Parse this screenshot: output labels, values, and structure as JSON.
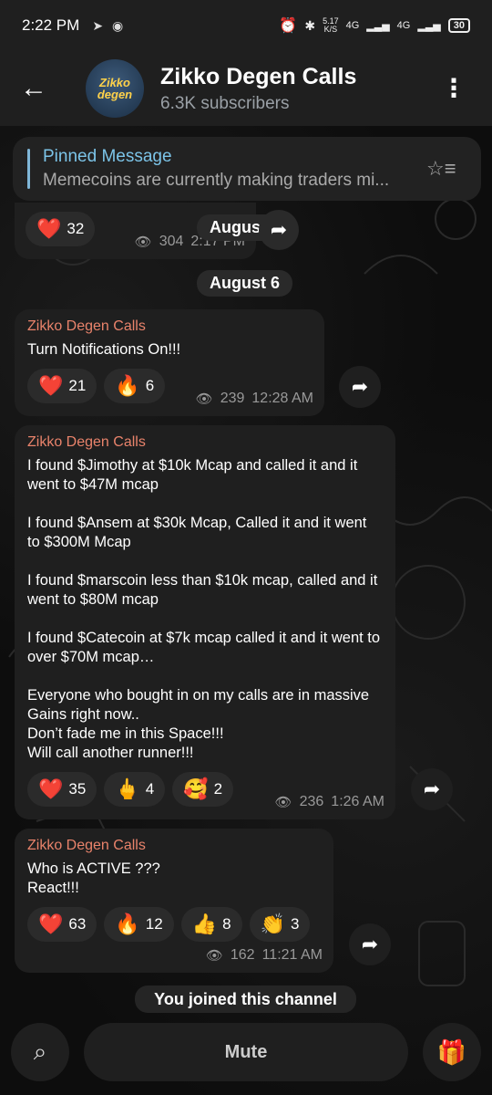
{
  "status_bar": {
    "time": "2:22 PM",
    "net_speed": "5.17\nK/S",
    "network_1": "4G",
    "network_2": "4G",
    "battery": "30"
  },
  "header": {
    "avatar_text": "Zikko degen",
    "title": "Zikko Degen Calls",
    "subscribers": "6.3K subscribers"
  },
  "pinned": {
    "title": "Pinned Message",
    "preview": "Memecoins are currently making traders mi..."
  },
  "previous_message": {
    "reaction": {
      "emoji": "❤️",
      "count": "32"
    },
    "views": "304",
    "time": "2:17 PM",
    "date_overlay": "August 5"
  },
  "date_separator": "August 6",
  "messages": [
    {
      "author": "Zikko Degen Calls",
      "text": "Turn Notifications On!!!",
      "reactions": [
        {
          "emoji": "❤️",
          "count": "21"
        },
        {
          "emoji": "🔥",
          "count": "6"
        }
      ],
      "views": "239",
      "time": "12:28 AM"
    },
    {
      "author": "Zikko Degen Calls",
      "text": "I found $Jimothy at $10k Mcap and called it and it went to $47M mcap\n\nI found  $Ansem at $30k Mcap, Called it and it went to $300M Mcap\n\nI found $marscoin less than $10k mcap, called and it went to $80M mcap\n\nI found $Catecoin at $7k mcap called it and it went to over $70M mcap…\n\nEveryone who bought in on my calls are in massive Gains right now..\nDon’t fade me in this Space!!!\nWill call another runner!!!",
      "reactions": [
        {
          "emoji": "❤️",
          "count": "35"
        },
        {
          "emoji": "🖕",
          "count": "4"
        },
        {
          "emoji": "🥰",
          "count": "2"
        }
      ],
      "views": "236",
      "time": "1:26 AM"
    },
    {
      "author": "Zikko Degen Calls",
      "text": "Who is ACTIVE ???\nReact!!!",
      "reactions": [
        {
          "emoji": "❤️",
          "count": "63"
        },
        {
          "emoji": "🔥",
          "count": "12"
        },
        {
          "emoji": "👍",
          "count": "8"
        },
        {
          "emoji": "👏",
          "count": "3"
        }
      ],
      "views": "162",
      "time": "11:21 AM"
    }
  ],
  "joined_notice": "You joined this channel",
  "bottom": {
    "mute_label": "Mute"
  },
  "colors": {
    "author": "#e9836b",
    "pinned_title": "#7cc4e8",
    "bubble": "#1f1f1f"
  }
}
